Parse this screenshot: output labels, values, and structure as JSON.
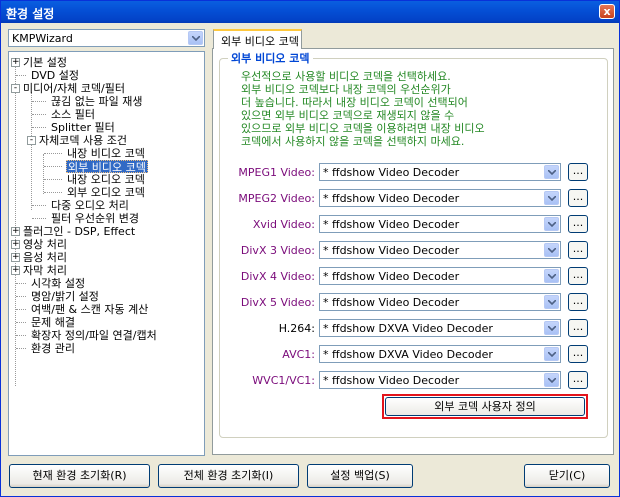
{
  "window": {
    "title": "환경 설정",
    "close_glyph": "x"
  },
  "preset": {
    "value": "KMPWizard"
  },
  "tree": [
    {
      "label": "기본 설정",
      "toggle": "+"
    },
    {
      "label": "DVD 설정",
      "toggle": ""
    },
    {
      "label": "미디어/자체 코덱/필터",
      "toggle": "-"
    },
    {
      "label": "끊김 없는 파일 재생",
      "toggle": ""
    },
    {
      "label": "소스 필터",
      "toggle": ""
    },
    {
      "label": "Splitter 필터",
      "toggle": ""
    },
    {
      "label": "자체코덱 사용 조건",
      "toggle": "-"
    },
    {
      "label": "내장 비디오 코덱",
      "toggle": ""
    },
    {
      "label": "외부 비디오 코덱",
      "toggle": "",
      "selected": true
    },
    {
      "label": "내장 오디오 코덱",
      "toggle": ""
    },
    {
      "label": "외부 오디오 코덱",
      "toggle": ""
    },
    {
      "label": "다중 오디오 처리",
      "toggle": ""
    },
    {
      "label": "필터 우선순위 변경",
      "toggle": ""
    },
    {
      "label": "플러그인 - DSP, Effect",
      "toggle": "+"
    },
    {
      "label": "영상 처리",
      "toggle": "+"
    },
    {
      "label": "음성 처리",
      "toggle": "+"
    },
    {
      "label": "자막 처리",
      "toggle": "+"
    },
    {
      "label": "시각화 설정",
      "toggle": ""
    },
    {
      "label": "명암/밝기 설정",
      "toggle": ""
    },
    {
      "label": "여백/팬 & 스캔 자동 계산",
      "toggle": ""
    },
    {
      "label": "문제 해결",
      "toggle": ""
    },
    {
      "label": "확장자 정의/파일 연결/캡처",
      "toggle": ""
    },
    {
      "label": "환경 관리",
      "toggle": ""
    }
  ],
  "tab": {
    "label": "외부 비디오 코덱"
  },
  "group": {
    "title": "외부 비디오 코덱",
    "description": "우선적으로 사용할 비디오 코덱을 선택하세요.\n외부 비디오 코덱보다 내장 코덱의 우선순위가\n더 높습니다. 따라서 내장 비디오 코덱이 선택되어\n있으면 외부 비디오 코덱으로 재생되지 않을 수\n있으므로 외부 비디오 코덱을 이용하려면 내장 비디오\n코덱에서 사용하지 않을 코덱을 선택하지 마세요."
  },
  "codecs": [
    {
      "label": "MPEG1 Video:",
      "value": "* ffdshow Video Decoder"
    },
    {
      "label": "MPEG2 Video:",
      "value": "* ffdshow Video Decoder"
    },
    {
      "label": "Xvid Video:",
      "value": "* ffdshow Video Decoder"
    },
    {
      "label": "DivX 3 Video:",
      "value": "* ffdshow Video Decoder"
    },
    {
      "label": "DivX 4 Video:",
      "value": "* ffdshow Video Decoder"
    },
    {
      "label": "DivX 5 Video:",
      "value": "* ffdshow Video Decoder"
    },
    {
      "label": "H.264:",
      "value": "* ffdshow DXVA Video Decoder"
    },
    {
      "label": "AVC1:",
      "value": "* ffdshow DXVA Video Decoder"
    },
    {
      "label": "WVC1/VC1:",
      "value": "* ffdshow Video Decoder"
    }
  ],
  "more_label": "...",
  "custom_button": {
    "label": "외부 코덱 사용자 정의"
  },
  "bottom_buttons": {
    "reset_current": "현재 환경 초기화(R)",
    "reset_all": "전체 환경 초기화(I)",
    "backup": "설정 백업(S)",
    "close": "닫기(C)"
  },
  "colors": {
    "accent": "#0046D5",
    "description": "#238823",
    "codec_label": "#7A0A7A",
    "highlight": "#E3141B"
  }
}
